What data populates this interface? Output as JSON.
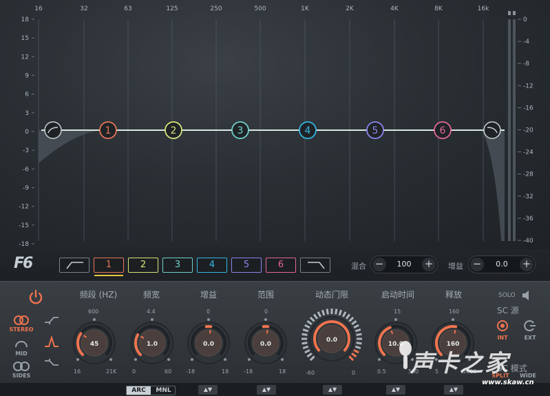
{
  "colors": {
    "band1": "#e9765c",
    "band2": "#d8e57a",
    "band3": "#6fd1cc",
    "band4": "#34b7e3",
    "band5": "#8c86f0",
    "band6": "#e46896",
    "accent": "#f0744f",
    "curve": "#d9e9e2"
  },
  "freq_ticks": [
    "16",
    "32",
    "63",
    "125",
    "250",
    "500",
    "1K",
    "2K",
    "4K",
    "8K",
    "16k"
  ],
  "db_left_ticks": [
    "18",
    "15",
    "12",
    "9",
    "6",
    "3",
    "0",
    "-3",
    "-6",
    "-9",
    "-12",
    "-15",
    "-18"
  ],
  "db_right_ticks": [
    "0",
    "-4",
    "-8",
    "-12",
    "-16",
    "-20",
    "-24",
    "-28",
    "-32",
    "-36",
    "-40"
  ],
  "nodes": [
    "1",
    "2",
    "3",
    "4",
    "5",
    "6"
  ],
  "logo": "F6",
  "bands": {
    "b1": "1",
    "b2": "2",
    "b3": "3",
    "b4": "4",
    "b5": "5",
    "b6": "6"
  },
  "mix": {
    "label": "混合",
    "value": "100",
    "minus": "−",
    "plus": "+"
  },
  "gain_out": {
    "label": "增益",
    "value": "0.0",
    "minus": "−",
    "plus": "+"
  },
  "knobs": {
    "freq": {
      "title": "频段 (HZ)",
      "value": "45",
      "top": "600",
      "min": "16",
      "max": "21K"
    },
    "width": {
      "title": "频宽",
      "value": "1.0",
      "top": "4.4",
      "min": "0",
      "max": "60"
    },
    "gain": {
      "title": "增益",
      "value": "0.0",
      "top": "0",
      "min": "-18",
      "max": "18"
    },
    "range": {
      "title": "范围",
      "value": "0.0",
      "top": "0",
      "min": "-18",
      "max": "18"
    },
    "threshold": {
      "title": "动态门限",
      "value": "0.0",
      "min": "-60",
      "max": "0"
    },
    "attack": {
      "title": "启动时间",
      "value": "10.0",
      "top": "15",
      "min": "0.5",
      "max": "500"
    },
    "release": {
      "title": "释放",
      "value": "160",
      "top": "160",
      "min": "5",
      "max": "5000"
    }
  },
  "modes": {
    "stereo": "STEREO",
    "mid": "MID",
    "sides": "SIDES"
  },
  "arc": "ARC",
  "mnl": "MNL",
  "spin_symbol": "▲▼",
  "sidechain": {
    "solo": "SOLO",
    "source": "SC 源",
    "int": "INT",
    "ext": "EXT",
    "mode": "SC 模式",
    "split": "SPLIT",
    "wide": "WIDE"
  },
  "watermark": {
    "text": "声卡之家",
    "url": "www.skaw.cn"
  }
}
